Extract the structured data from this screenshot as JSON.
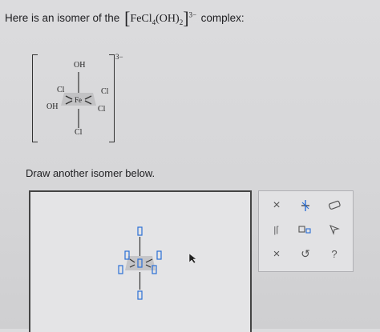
{
  "question": {
    "prefix": "Here is an isomer of the",
    "formula_main": "FeCl",
    "formula_sub1": "4",
    "formula_mid": "(OH)",
    "formula_sub2": "2",
    "formula_charge": "3−",
    "suffix": "complex:"
  },
  "given_isomer": {
    "charge": "3−",
    "center": "Fe",
    "top": "OH",
    "bottom": "Cl",
    "left_upper": "Cl",
    "left_lower": "OH",
    "right_upper": "Cl",
    "right_lower": "Cl"
  },
  "draw_prompt": "Draw another isomer below.",
  "toolbar": {
    "row1": [
      "close-icon",
      "atom-add-icon",
      "eraser-icon"
    ],
    "row2": [
      "bracket-icon",
      "charge-icon",
      "select-arrow-icon"
    ],
    "row3": [
      "clear-icon",
      "undo-icon",
      "help-icon"
    ],
    "labels": {
      "close": "×",
      "clear": "×",
      "undo": "↺",
      "help": "?",
      "bracket": "|⌈"
    }
  }
}
